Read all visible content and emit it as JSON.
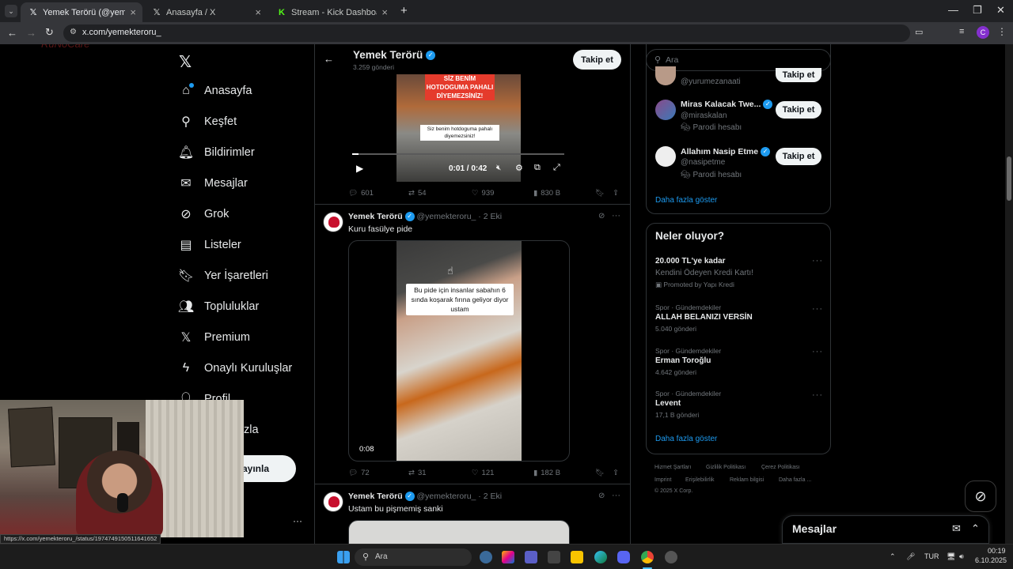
{
  "browser": {
    "tabs": [
      {
        "title": "Yemek Terörü (@yemekteroru_)",
        "active": true,
        "icon": "x-logo"
      },
      {
        "title": "Anasayfa / X",
        "active": false,
        "icon": "x-logo"
      },
      {
        "title": "Stream - Kick Dashboard",
        "active": false,
        "icon": "kick-logo"
      }
    ],
    "new_tab": "+",
    "url": "x.com/yemekteroru_",
    "profile_initial": "C",
    "hover_url": "https://x.com/yemekteroru_/status/1974749150511641652"
  },
  "left_nav": {
    "items": [
      {
        "label": "Anasayfa",
        "icon": "home-icon"
      },
      {
        "label": "Keşfet",
        "icon": "search-icon"
      },
      {
        "label": "Bildirimler",
        "icon": "bell-icon"
      },
      {
        "label": "Mesajlar",
        "icon": "mail-icon"
      },
      {
        "label": "Grok",
        "icon": "grok-icon"
      },
      {
        "label": "Listeler",
        "icon": "list-icon"
      },
      {
        "label": "Yer İşaretleri",
        "icon": "bookmark-icon"
      },
      {
        "label": "Topluluklar",
        "icon": "communities-icon"
      },
      {
        "label": "Premium",
        "icon": "x-logo-icon"
      },
      {
        "label": "Onaylı Kuruluşlar",
        "icon": "lightning-icon"
      },
      {
        "label": "Profil",
        "icon": "profile-icon"
      },
      {
        "label": "Daha fazla",
        "icon": "more-icon"
      }
    ],
    "visible_more_fragment": "zla",
    "post_button": "ayınla",
    "more_dots": "···"
  },
  "profile_header": {
    "name": "Yemek Terörü",
    "posts": "3.259 gönderi",
    "follow": "Takip et"
  },
  "tweets": [
    {
      "video_caption_top": "SİZ BENİM HOTDOGUMA PAHALI DİYEMEZSİNİZ!",
      "video_caption_bottom": "Siz benim hotdoguma pahalı diyemezsiniz!",
      "video_time": "0:01 / 0:42",
      "replies": "601",
      "reposts": "54",
      "likes": "939",
      "views": "830 B"
    },
    {
      "name": "Yemek Terörü",
      "handle": "@yemekteroru_",
      "time": "· 2 Eki",
      "text": "Kuru fasülye pide",
      "video_caption": "Bu pide için insanlar sabahın 6 sında koşarak fırına geliyor diyor ustam",
      "video_time": "0:08",
      "replies": "72",
      "reposts": "31",
      "likes": "121",
      "views": "182 B"
    },
    {
      "name": "Yemek Terörü",
      "handle": "@yemekteroru_",
      "time": "· 2 Eki",
      "text": "Ustam bu pişmemiş sanki"
    }
  ],
  "right": {
    "search_placeholder": "Ara",
    "who_to_follow": [
      {
        "name": "",
        "handle": "@yurumezanaati",
        "follow": "Takip et"
      },
      {
        "name": "Miras Kalacak Twe...",
        "handle": "@miraskalan",
        "label": "Parodi hesabı",
        "follow": "Takip et"
      },
      {
        "name": "Allahım Nasip Etme",
        "handle": "@nasipetme",
        "label": "Parodi hesabı",
        "follow": "Takip et"
      }
    ],
    "show_more": "Daha fazla göster",
    "trends_title": "Neler oluyor?",
    "promo": {
      "name": "20.000 TL'ye kadar",
      "desc": "Kendini Ödeyen Kredi Kartı!",
      "by": "Promoted by Yapı Kredi"
    },
    "trends": [
      {
        "cat": "Spor · Gündemdekiler",
        "name": "ALLAH BELANIZI VERSİN",
        "count": "5.040 gönderi"
      },
      {
        "cat": "Spor · Gündemdekiler",
        "name": "Erman Toroğlu",
        "count": "4.642 gönderi"
      },
      {
        "cat": "Spor · Gündemdekiler",
        "name": "Levent",
        "count": "17,1 B gönderi"
      }
    ],
    "trends_more": "Daha fazla göster",
    "footer": [
      "Hizmet Şartları",
      "Gizlilik Politikası",
      "Çerez Politikası",
      "Imprint",
      "Erişilebilirlik",
      "Reklam bilgisi",
      "Daha fazla ...",
      "© 2025 X Corp."
    ],
    "messages": "Mesajlar"
  },
  "taskbar": {
    "search": "Ara",
    "lang": "TUR",
    "time": "00:19",
    "date": "6.10.2025"
  },
  "colors": {
    "accent": "#1d9bf0",
    "bg": "#000000",
    "border": "#2f3336",
    "muted": "#71767b"
  }
}
